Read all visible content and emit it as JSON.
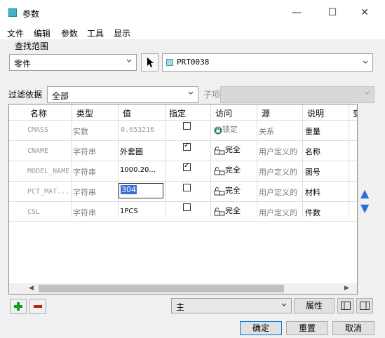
{
  "window": {
    "title": "参数"
  },
  "menu": [
    "文件",
    "编辑",
    "参数",
    "工具",
    "显示"
  ],
  "search_scope": {
    "label": "查找范围",
    "scope_value": "零件",
    "model_value": "PRT0038"
  },
  "filter": {
    "label": "过滤依据",
    "value": "全部",
    "sub_label": "子项"
  },
  "table": {
    "columns": [
      "名称",
      "类型",
      "值",
      "指定",
      "访问",
      "源",
      "说明",
      "变"
    ],
    "rows": [
      {
        "name": "CMASS",
        "type": "实数",
        "value": "0.653216",
        "designated": false,
        "show_check": true,
        "access": "锁定",
        "source": "关系",
        "desc": "重量"
      },
      {
        "name": "CNAME",
        "type": "字符串",
        "value": "外套圈",
        "designated": true,
        "show_check": true,
        "access": "完全",
        "source": "用户定义的",
        "desc": "名称"
      },
      {
        "name": "MODEL_NAME",
        "type": "字符串",
        "value": "1000.20...",
        "designated": true,
        "show_check": true,
        "access": "完全",
        "source": "用户定义的",
        "desc": "图号"
      },
      {
        "name": "PCT_MAT...",
        "type": "字符串",
        "value": "304",
        "designated": false,
        "show_check": true,
        "access": "完全",
        "source": "用户定义的",
        "desc": "材料"
      },
      {
        "name": "CSL",
        "type": "字符串",
        "value": "1PCS",
        "designated": false,
        "show_check": true,
        "access": "完全",
        "source": "用户定义的",
        "desc": "件数"
      }
    ]
  },
  "bottom": {
    "main_select": "主",
    "properties_label": "属性",
    "ok_label": "确定",
    "reset_label": "重置",
    "cancel_label": "取消"
  },
  "colors": {
    "add": "#1a9a1a",
    "remove": "#c0201a",
    "arrows": "#2a6fd4",
    "selection": "#3b6fd6"
  }
}
